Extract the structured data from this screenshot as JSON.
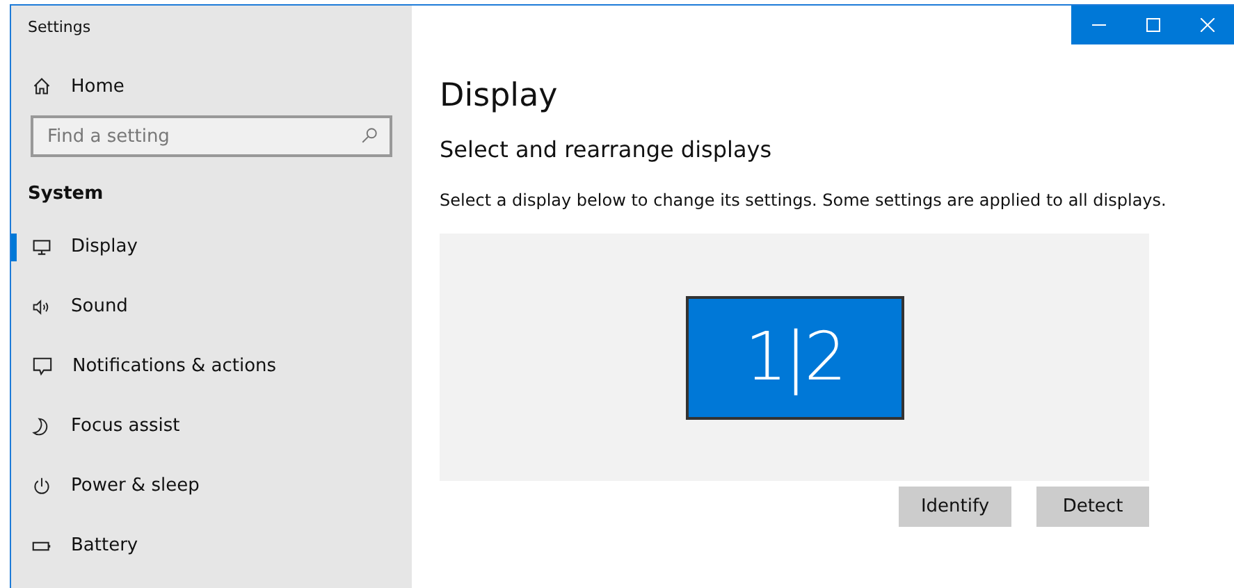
{
  "window": {
    "title": "Settings"
  },
  "sidebar": {
    "home": "Home",
    "search": {
      "placeholder": "Find a setting"
    },
    "section": "System",
    "items": [
      {
        "label": "Display",
        "kind": "display",
        "selected": true
      },
      {
        "label": "Sound",
        "kind": "sound",
        "selected": false
      },
      {
        "label": "Notifications & actions",
        "kind": "notifications",
        "selected": false
      },
      {
        "label": "Focus assist",
        "kind": "focus",
        "selected": false
      },
      {
        "label": "Power & sleep",
        "kind": "power",
        "selected": false
      },
      {
        "label": "Battery",
        "kind": "battery",
        "selected": false
      }
    ]
  },
  "page": {
    "title": "Display",
    "subtitle": "Select and rearrange displays",
    "description": "Select a display below to change its settings. Some settings are applied to all displays.",
    "monitor": {
      "label": "1|2",
      "selected": true
    },
    "buttons": [
      "Identify",
      "Detect"
    ]
  }
}
